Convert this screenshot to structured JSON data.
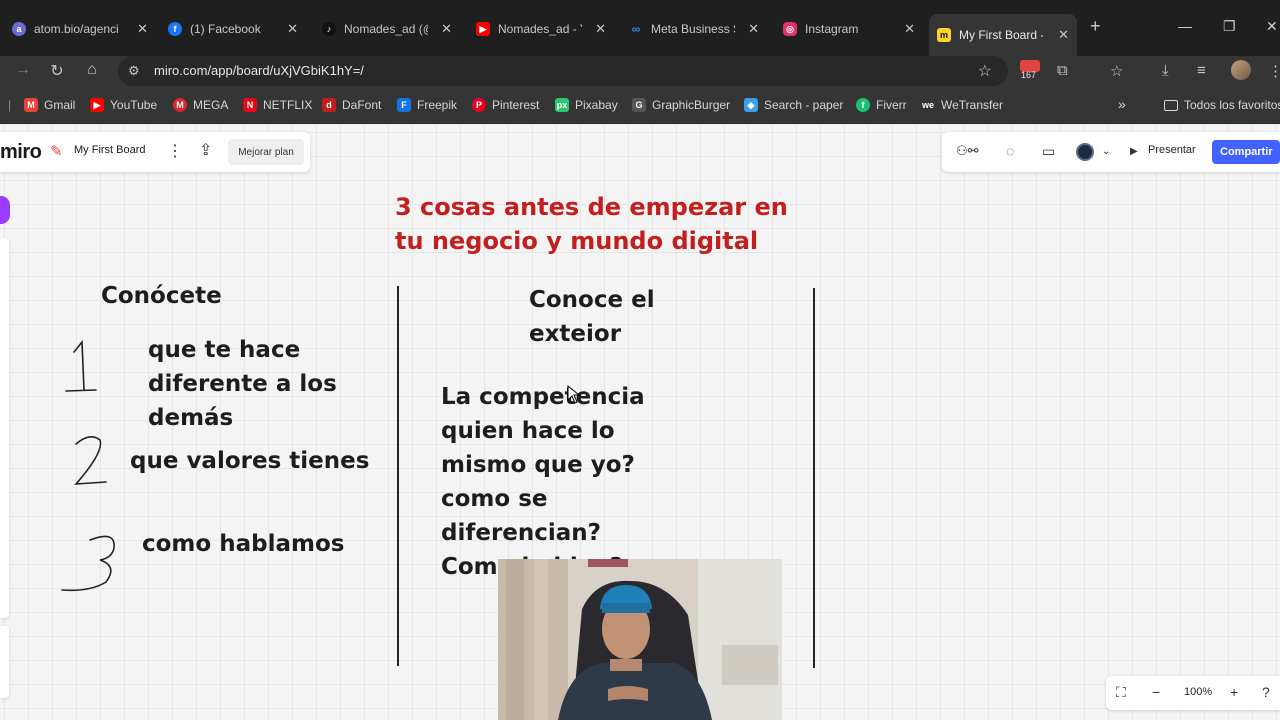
{
  "browser": {
    "tabs": [
      {
        "label": "atom.bio/agenci",
        "icon": "atom-bio-icon",
        "color": "#6b6bd6"
      },
      {
        "label": "(1) Facebook",
        "icon": "facebook-icon",
        "color": "#1877f2"
      },
      {
        "label": "Nomades_ad (@",
        "icon": "tiktok-icon",
        "color": "#111111"
      },
      {
        "label": "Nomades_ad - Y",
        "icon": "youtube-icon",
        "color": "#ff0000"
      },
      {
        "label": "Meta Business S",
        "icon": "meta-icon",
        "color": "#0668e1"
      },
      {
        "label": "Instagram",
        "icon": "instagram-icon",
        "color": "#e1306c"
      },
      {
        "label": "My First Board -",
        "icon": "miro-icon",
        "color": "#ffd02f",
        "active": true
      }
    ],
    "new_tab": "+",
    "url": "miro.com/app/board/uXjVGbiK1hY=/",
    "extension_badge": "167",
    "bookmarks": [
      {
        "label": "Gmail",
        "icon": "gmail-icon",
        "color": "#ea4335"
      },
      {
        "label": "YouTube",
        "icon": "youtube-icon",
        "color": "#ff0000"
      },
      {
        "label": "MEGA",
        "icon": "mega-icon",
        "color": "#d9272e"
      },
      {
        "label": "NETFLIX",
        "icon": "netflix-icon",
        "color": "#e50914"
      },
      {
        "label": "DaFont",
        "icon": "dafont-icon",
        "color": "#c41f1f"
      },
      {
        "label": "Freepik",
        "icon": "freepik-icon",
        "color": "#1273eb"
      },
      {
        "label": "Pinterest",
        "icon": "pinterest-icon",
        "color": "#e60023"
      },
      {
        "label": "Pixabay",
        "icon": "pixabay-icon",
        "color": "#2ec66d"
      },
      {
        "label": "GraphicBurger",
        "icon": "graphicburger-icon",
        "color": "#555555"
      },
      {
        "label": "Search - paper",
        "icon": "paper-icon",
        "color": "#3aa0e8"
      },
      {
        "label": "Fiverr",
        "icon": "fiverr-icon",
        "color": "#1dbf73"
      },
      {
        "label": "WeTransfer",
        "icon": "wetransfer-icon",
        "color": "#333333"
      }
    ],
    "all_bookmarks": "Todos los favoritos"
  },
  "miro": {
    "logo": "miro",
    "board_name": "My First Board",
    "upgrade_label": "Mejorar plan",
    "present_label": "Presentar",
    "share_label": "Compartir",
    "zoom": "100%"
  },
  "board": {
    "title": "3 cosas antes de empezar en tu negocio y mundo digital",
    "col1_heading": "Conócete",
    "col2_heading": "Conoce el exteior",
    "numbers": [
      "1",
      "2",
      "3"
    ],
    "items": [
      "que te hace diferente a los demás",
      "que valores tienes",
      "como hablamos"
    ],
    "competition_text": "La competencia quien hace lo mismo que yo? como se diferencian? Como hablan?"
  },
  "colors": {
    "title": "#c31f1f",
    "share_button": "#4262ff",
    "browser_bg": "#1f1f1f"
  }
}
